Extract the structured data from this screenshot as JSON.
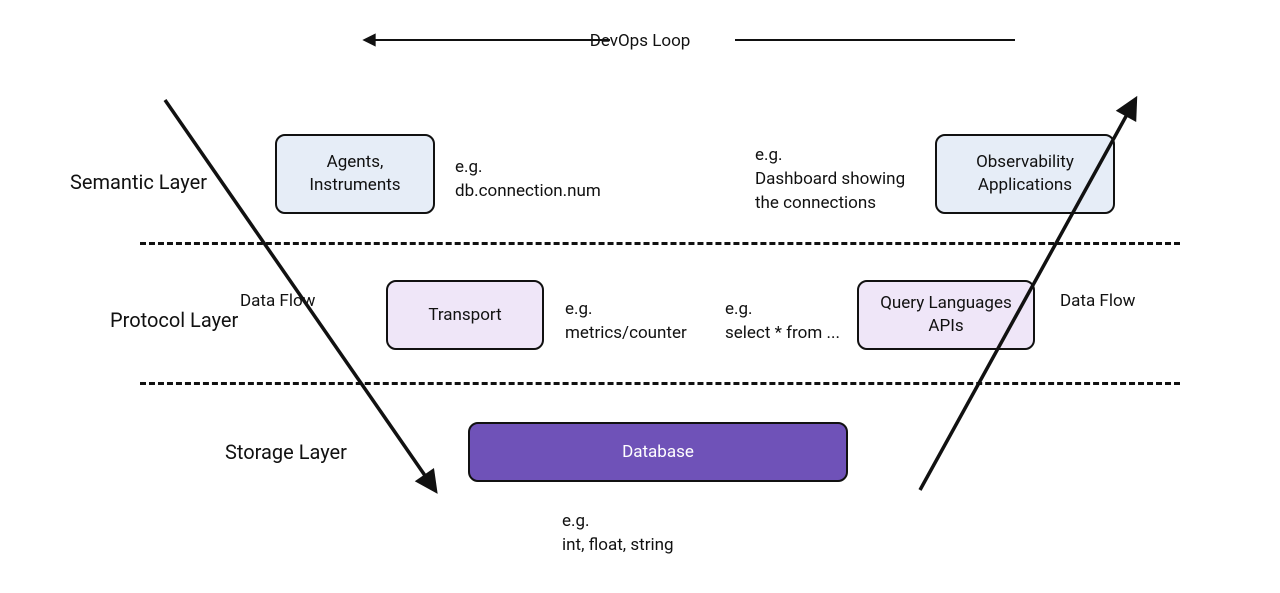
{
  "top": {
    "loop": "DevOps Loop"
  },
  "layers": {
    "semantic": "Semantic Layer",
    "protocol": "Protocol Layer",
    "storage": "Storage Layer"
  },
  "boxes": {
    "agents": "Agents,\nInstruments",
    "observability": "Observability\nApplications",
    "transport": "Transport",
    "query": "Query Languages\nAPIs",
    "database": "Database"
  },
  "examples": {
    "agents_eg": "e.g.\ndb.connection.num",
    "obs_eg": "e.g.\nDashboard showing\nthe connections",
    "transport_eg": "e.g.\nmetrics/counter",
    "query_eg": "e.g.\nselect * from ...",
    "storage_eg": "e.g.\nint, float, string"
  },
  "flows": {
    "left": "Data Flow",
    "right": "Data Flow"
  }
}
